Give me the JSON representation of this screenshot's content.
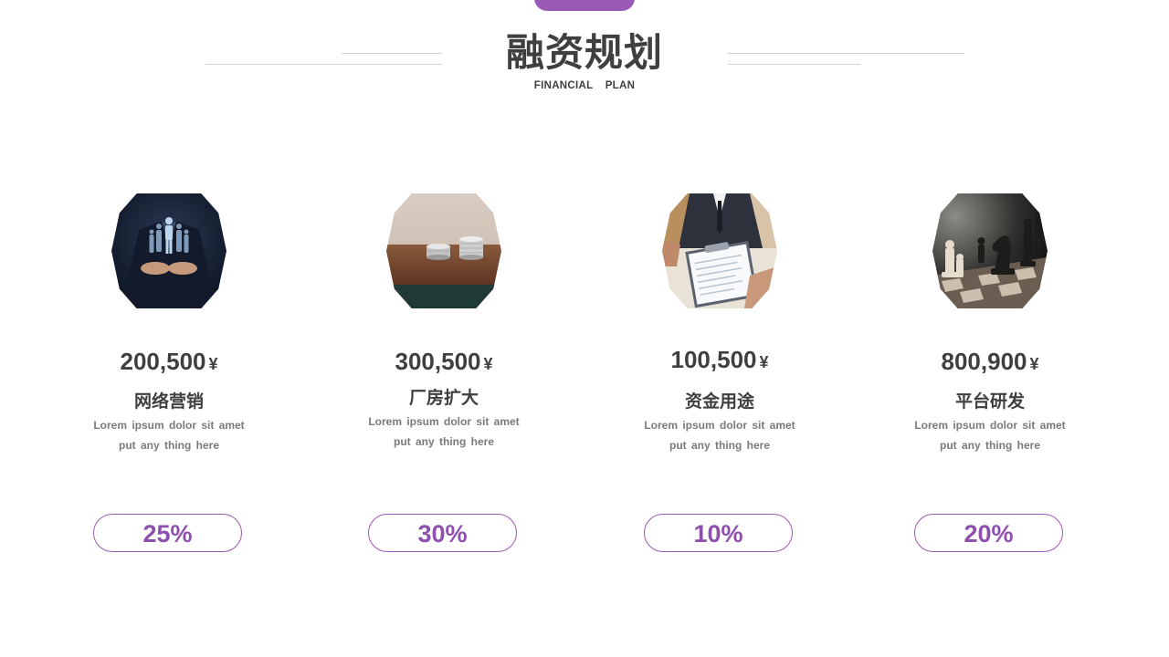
{
  "header": {
    "title": "融资规划",
    "subtitle": "FINANCIAL PLAN",
    "accent_color": "#9b59b6"
  },
  "cards": [
    {
      "amount": "200,500",
      "currency": "¥",
      "title": "网络营销",
      "desc_line1": "Lorem ipsum dolor sit amet",
      "desc_line2": "put any thing here",
      "percent": "25%",
      "image": "business-team-hands-photo"
    },
    {
      "amount": "300,500",
      "currency": "¥",
      "title": "厂房扩大",
      "desc_line1": "Lorem ipsum dolor sit amet",
      "desc_line2": "put any thing here",
      "percent": "30%",
      "image": "coin-stacks-photo"
    },
    {
      "amount": "100,500",
      "currency": "¥",
      "title": "资金用途",
      "desc_line1": "Lorem ipsum dolor sit amet",
      "desc_line2": "put any thing here",
      "percent": "10%",
      "image": "resume-clipboard-photo"
    },
    {
      "amount": "800,900",
      "currency": "¥",
      "title": "平台研发",
      "desc_line1": "Lorem ipsum dolor sit amet",
      "desc_line2": "put any thing here",
      "percent": "20%",
      "image": "chess-pieces-photo"
    }
  ]
}
